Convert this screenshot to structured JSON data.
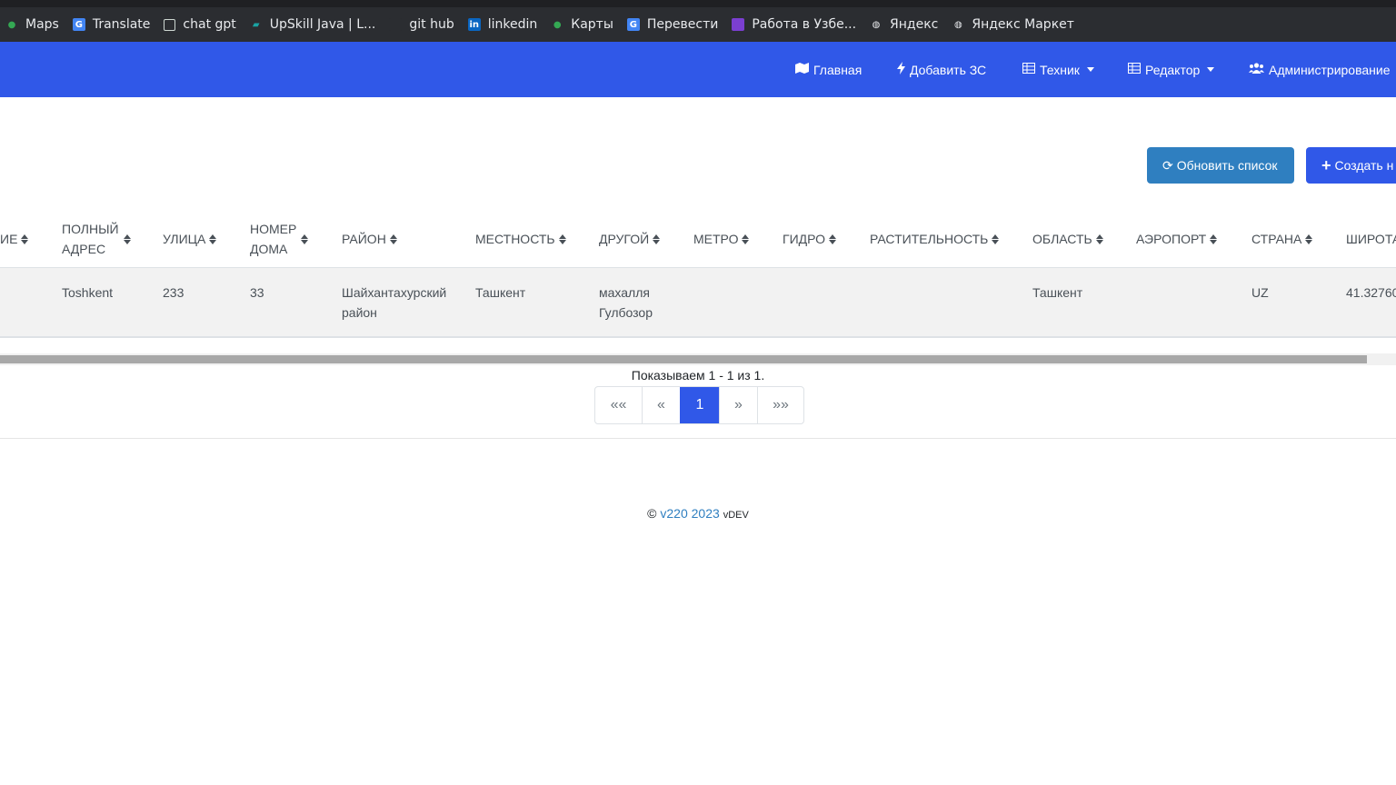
{
  "bookmarks": [
    {
      "label": "Maps",
      "icon": "maps-pin-icon"
    },
    {
      "label": "Translate",
      "icon": "translate-icon"
    },
    {
      "label": "chat gpt",
      "icon": "chatgpt-icon"
    },
    {
      "label": "UpSkill Java | L...",
      "icon": "upskill-icon"
    },
    {
      "label": "git hub",
      "icon": "github-icon"
    },
    {
      "label": "linkedin",
      "icon": "linkedin-icon"
    },
    {
      "label": "Карты",
      "icon": "maps-pin-icon"
    },
    {
      "label": "Перевести",
      "icon": "translate-icon"
    },
    {
      "label": "Работа в Узбе...",
      "icon": "purple-square-icon"
    },
    {
      "label": "Яндекс",
      "icon": "globe-icon"
    },
    {
      "label": "Яндекс Маркет",
      "icon": "globe-icon"
    }
  ],
  "navbar": {
    "home": "Главная",
    "add": "Добавить ЗС",
    "tech": "Техник",
    "editor": "Редактор",
    "admin": "Администрирование"
  },
  "toolbar": {
    "refresh": "Обновить список",
    "create": "Создать н"
  },
  "table": {
    "headers": [
      {
        "key": "name",
        "label": "ИЕ"
      },
      {
        "key": "full_address",
        "label": "ПОЛНЫЙ АДРЕС",
        "line1": "ПОЛНЫЙ",
        "line2": "АДРЕС"
      },
      {
        "key": "street",
        "label": "УЛИЦА"
      },
      {
        "key": "house",
        "label": "НОМЕР ДОМА",
        "line1": "НОМЕР",
        "line2": "ДОМА"
      },
      {
        "key": "district",
        "label": "РАЙОН"
      },
      {
        "key": "locality",
        "label": "МЕСТНОСТЬ"
      },
      {
        "key": "other",
        "label": "ДРУГОЙ"
      },
      {
        "key": "metro",
        "label": "МЕТРО"
      },
      {
        "key": "hydro",
        "label": "ГИДРО"
      },
      {
        "key": "vegetation",
        "label": "РАСТИТЕЛЬНОСТЬ"
      },
      {
        "key": "region",
        "label": "ОБЛАСТЬ"
      },
      {
        "key": "airport",
        "label": "АЭРОПОРТ"
      },
      {
        "key": "country",
        "label": "СТРАНА"
      },
      {
        "key": "latitude",
        "label": "ШИРОТА"
      }
    ],
    "rows": [
      {
        "full_address": "Toshkent",
        "street": "233",
        "house": "33",
        "district_line1": "Шайхантахурский",
        "district_line2": "район",
        "locality": "Ташкент",
        "other_line1": "махалля",
        "other_line2": "Гулбозор",
        "region": "Ташкент",
        "country": "UZ",
        "latitude": "41.32760"
      }
    ]
  },
  "pagination": {
    "showing": "Показываем 1 - 1 из 1.",
    "first": "««",
    "prev": "«",
    "current": "1",
    "next": "»",
    "last": "»»"
  },
  "footer": {
    "copyright": "©",
    "version": "v220 2023",
    "env": "vDEV"
  },
  "colors": {
    "primary": "#3058e8",
    "info": "#2f7fc0"
  }
}
